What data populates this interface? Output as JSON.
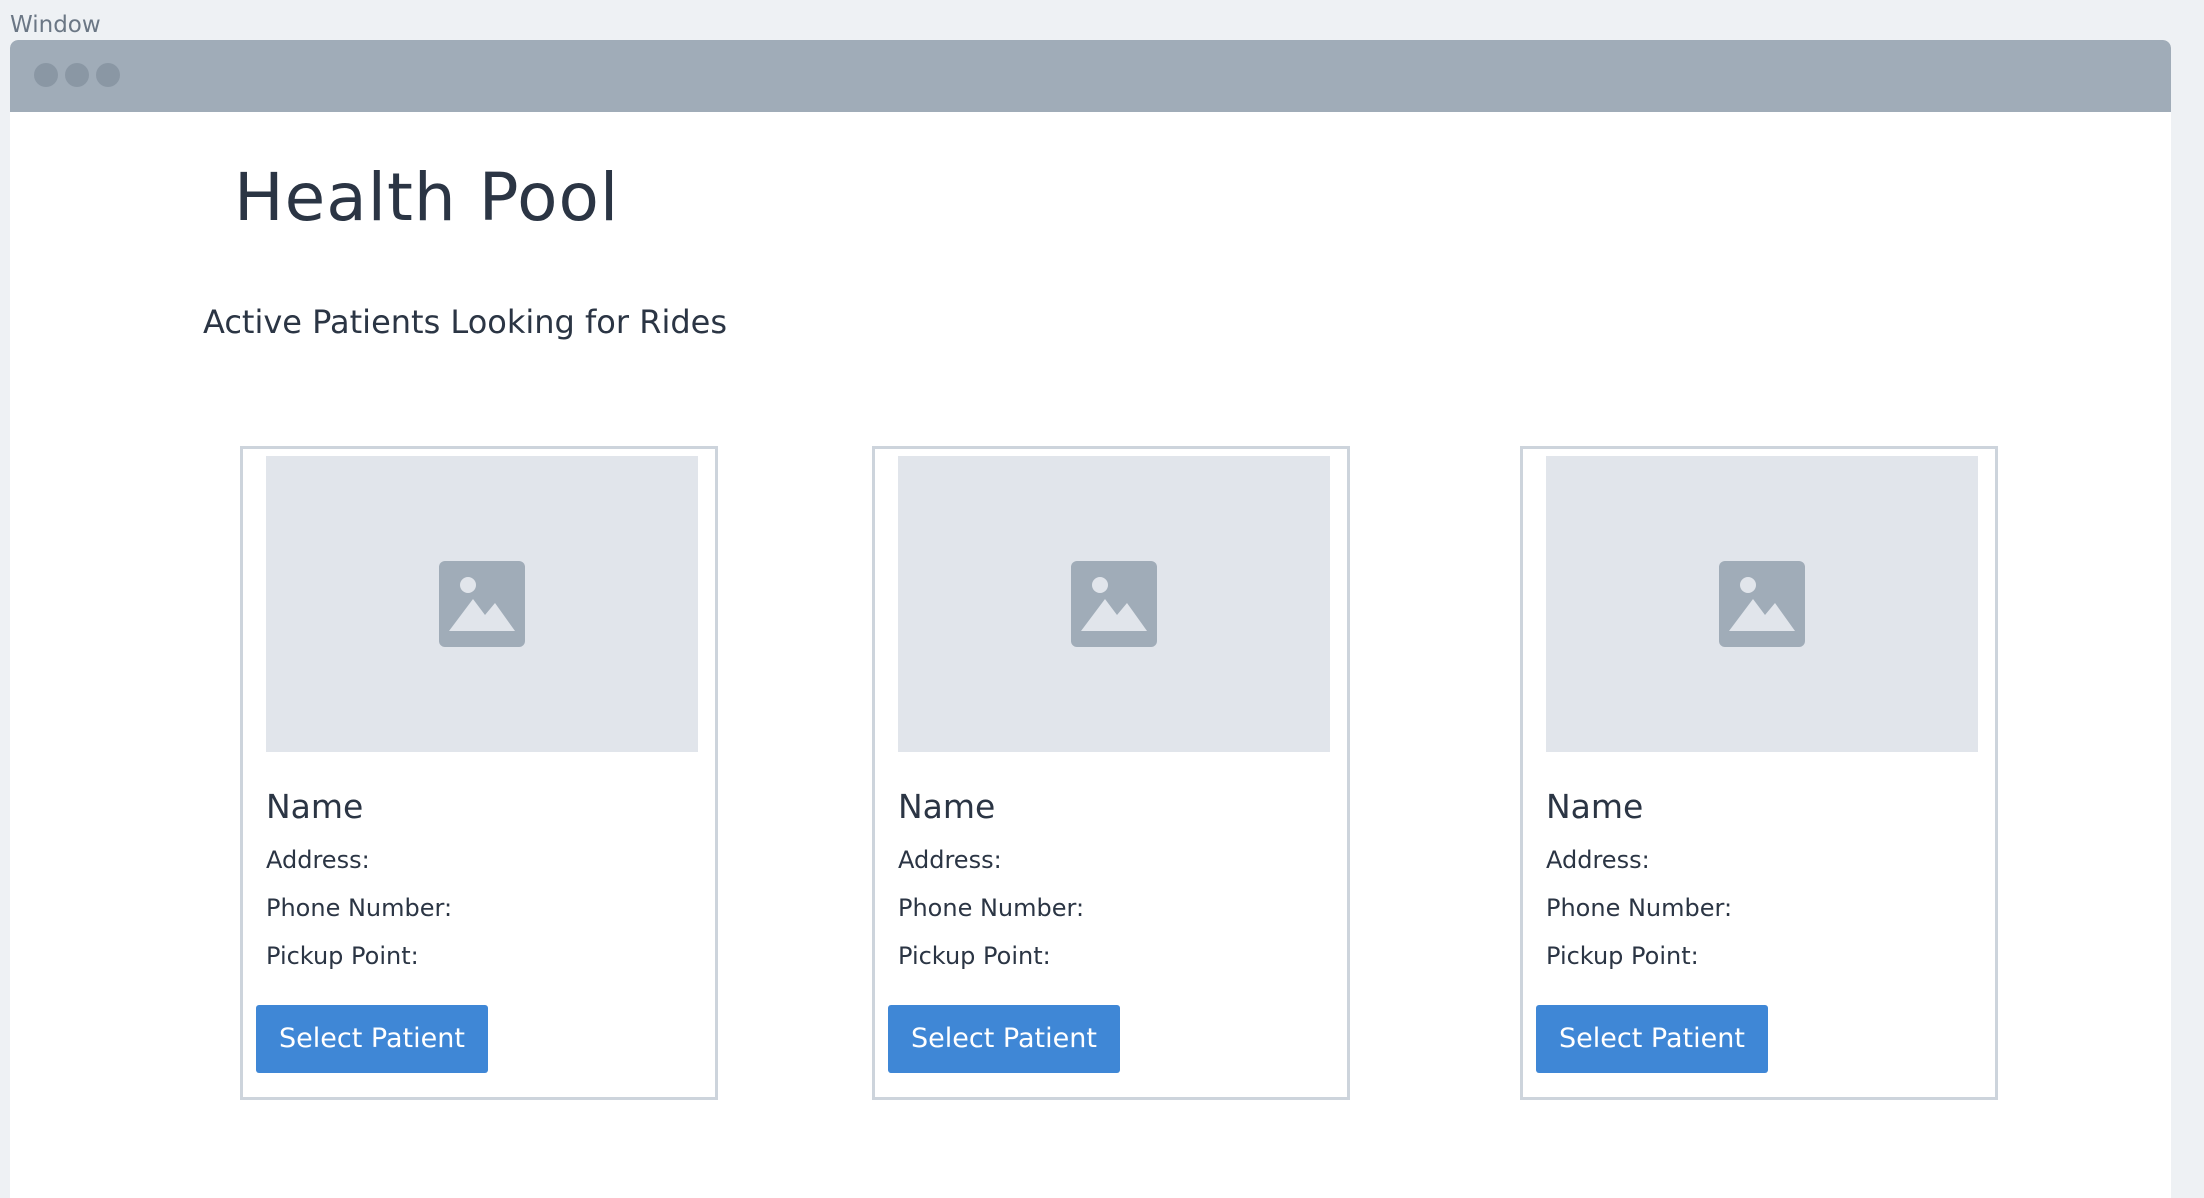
{
  "frame": {
    "label": "Window"
  },
  "app": {
    "title": "Health Pool",
    "subtitle": "Active Patients Looking for Rides"
  },
  "colors": {
    "accent": "#3f87d6",
    "titlebar": "#a0acb8",
    "text": "#2b3544",
    "card_border": "#cdd4dc",
    "placeholder": "#e1e5eb"
  },
  "cards": [
    {
      "image_icon": "image-placeholder-icon",
      "name": "Name",
      "address_label": "Address:",
      "phone_label": "Phone Number:",
      "pickup_label": "Pickup Point:",
      "button_label": "Select Patient"
    },
    {
      "image_icon": "image-placeholder-icon",
      "name": "Name",
      "address_label": "Address:",
      "phone_label": "Phone Number:",
      "pickup_label": "Pickup Point:",
      "button_label": "Select Patient"
    },
    {
      "image_icon": "image-placeholder-icon",
      "name": "Name",
      "address_label": "Address:",
      "phone_label": "Phone Number:",
      "pickup_label": "Pickup Point:",
      "button_label": "Select Patient"
    }
  ]
}
